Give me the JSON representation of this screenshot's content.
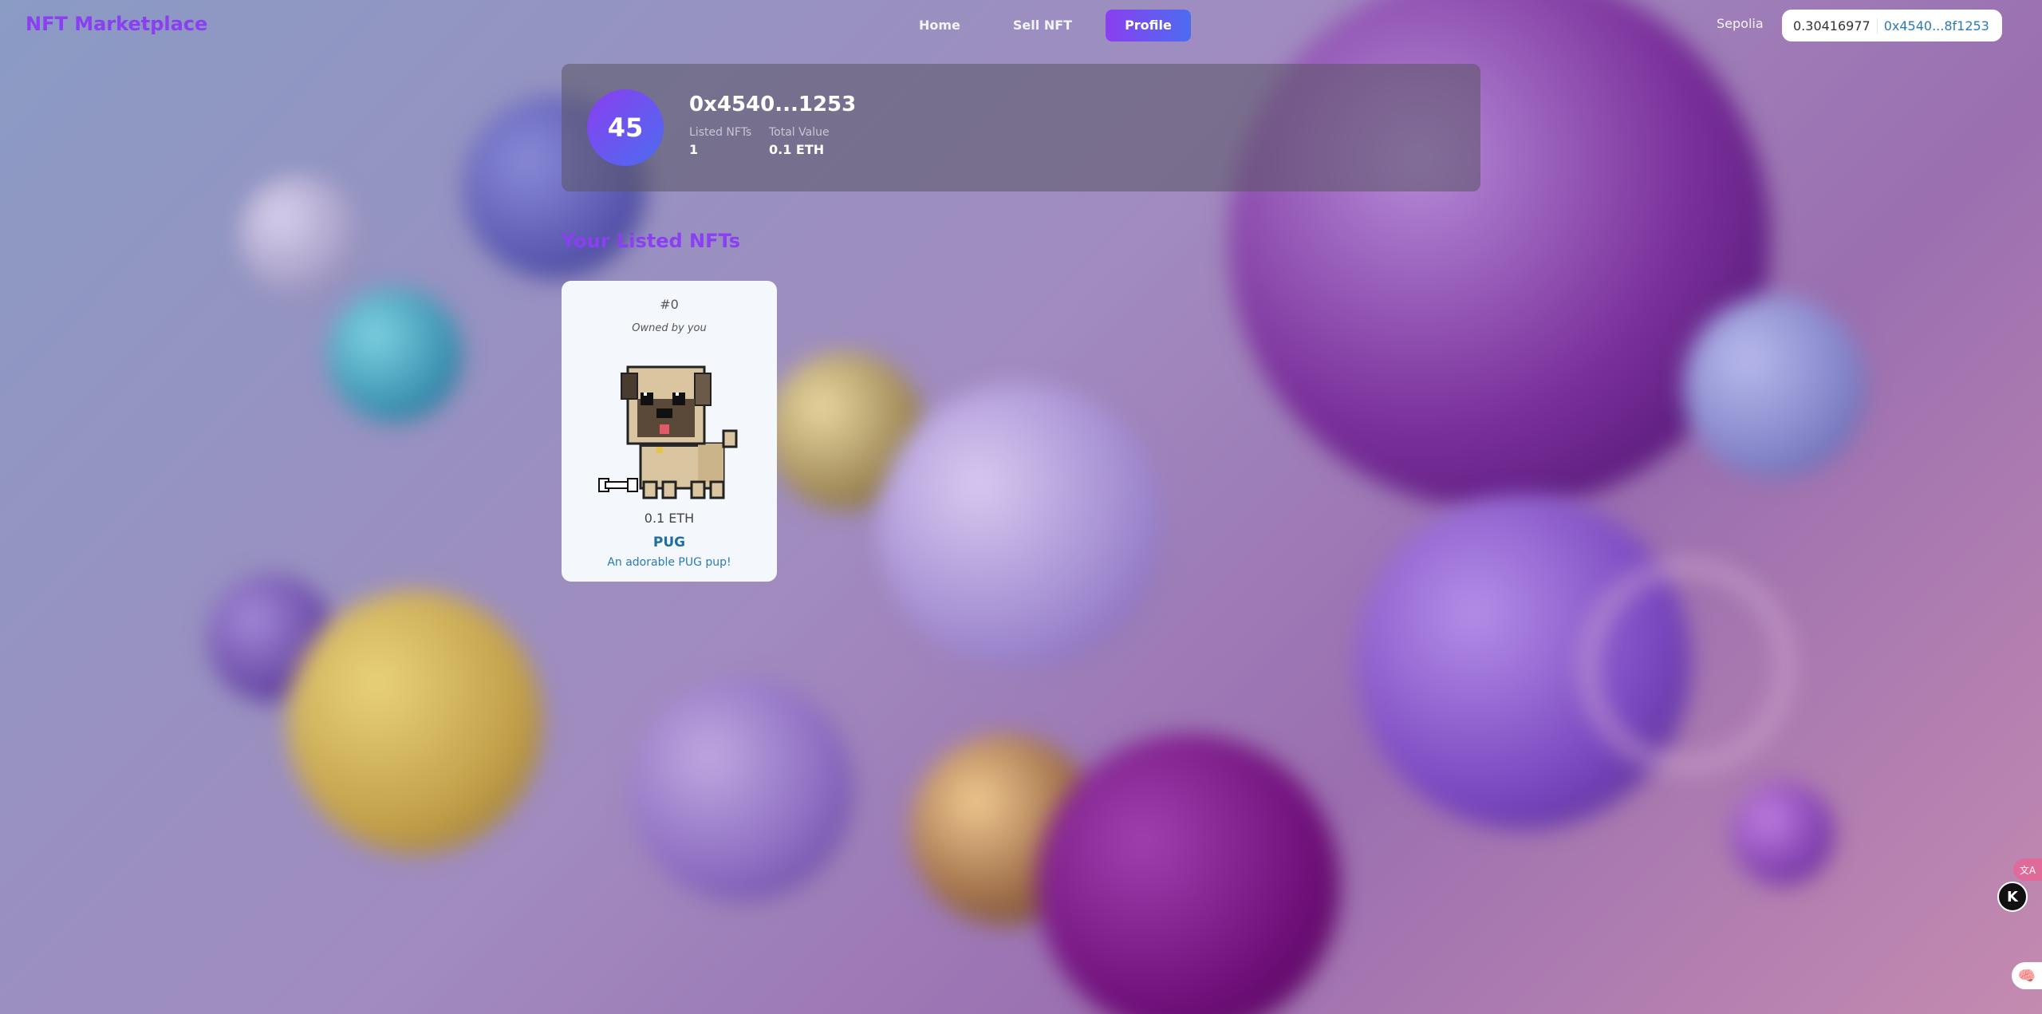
{
  "nav": {
    "brand": "NFT Marketplace",
    "links": [
      {
        "label": "Home",
        "active": false
      },
      {
        "label": "Sell NFT",
        "active": false
      },
      {
        "label": "Profile",
        "active": true
      }
    ],
    "network": "Sepolia",
    "wallet": {
      "balance": "0.30416977",
      "address": "0x4540...8f1253"
    }
  },
  "profile": {
    "avatar_text": "45",
    "address": "0x4540...1253",
    "stats": [
      {
        "label": "Listed NFTs",
        "value": "1"
      },
      {
        "label": "Total Value",
        "value": "0.1 ETH"
      }
    ]
  },
  "section_title": "Your Listed NFTs",
  "nfts": [
    {
      "id": "#0",
      "owner": "Owned by you",
      "image": "pixel-pug-icon",
      "price": "0.1 ETH",
      "name": "PUG",
      "description": "An adorable PUG pup!"
    }
  ],
  "widgets": {
    "translate_glyph": "文A",
    "k_glyph": "K",
    "brain_glyph": "🧠"
  },
  "colors": {
    "accent_purple": "#8a3ff0",
    "accent_blue": "#4c6cf0",
    "link_blue": "#2a7ab8"
  }
}
